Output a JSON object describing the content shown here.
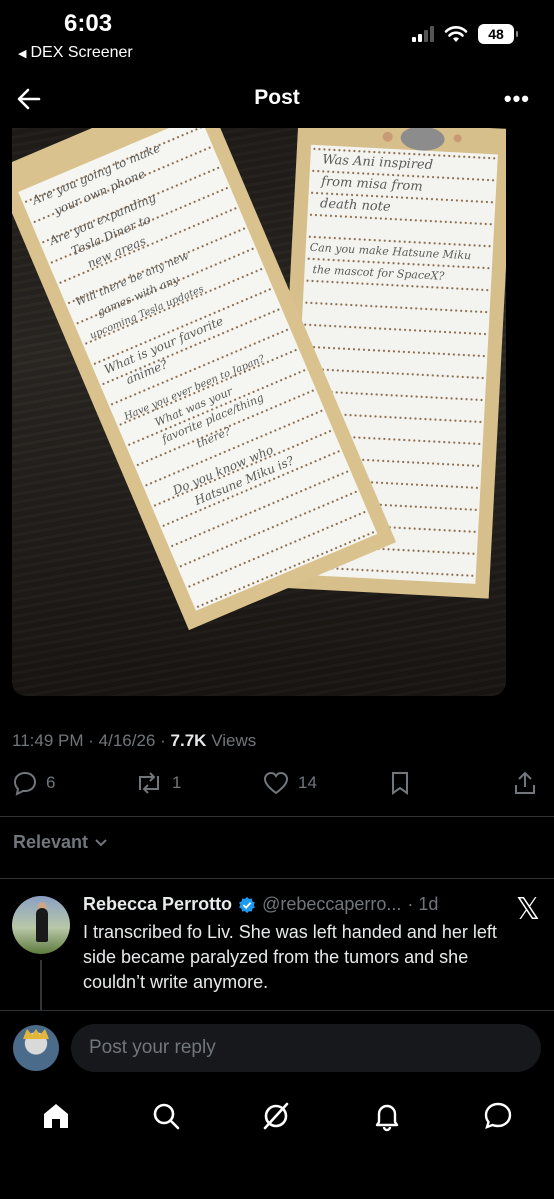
{
  "status": {
    "time": "6:03",
    "back_app": "DEX Screener",
    "battery": "48"
  },
  "nav": {
    "title": "Post",
    "more_icon": "more-icon"
  },
  "post": {
    "image_alt_icon": "photo",
    "time": "11:49 PM",
    "date": "4/16/26",
    "views_count": "7.7K",
    "views_label": "Views",
    "separator": "·",
    "replies": "6",
    "reposts": "1",
    "likes": "14"
  },
  "photo_text": {
    "left_lines": [
      "Are you going to make",
      "your own phone",
      "Are you expanding",
      "Tesla Diner to",
      "new areas",
      "Will there be any new",
      "games with any",
      "upcoming Tesla updates",
      "What is your favorite",
      "anime?",
      "Have you ever been to Japan?",
      "What was your",
      "favorite place/thing",
      "there?",
      "Do you know who",
      "Hatsune Miku is?"
    ],
    "right_lines": [
      "Was Ani inspired",
      "from misa from",
      "death note",
      "Can you make Hatsune Miku",
      "the mascot for SpaceX?"
    ]
  },
  "filter": {
    "label": "Relevant"
  },
  "reply": {
    "name": "Rebecca Perrotto",
    "handle": "@rebeccaperro...",
    "age": "· 1d",
    "text": "I transcribed fo Liv. She was left handed and her left side became paralyzed from the tumors and she couldn’t write anymore."
  },
  "composer": {
    "placeholder": "Post your reply"
  },
  "colors": {
    "background": "#000000",
    "text_primary": "#e7e9ea",
    "text_secondary": "#71767b",
    "verified": "#1d9bf0",
    "paper_tan": "#d8c28e"
  }
}
